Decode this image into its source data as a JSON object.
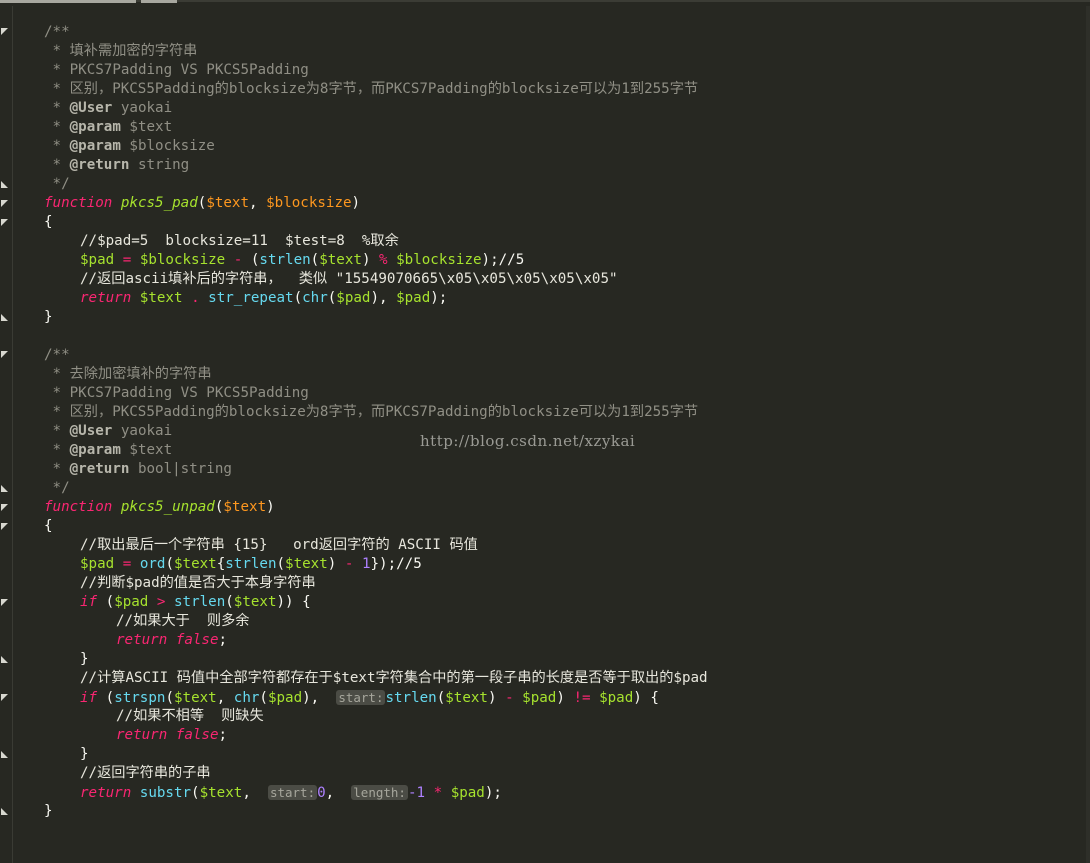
{
  "watermark": "http://blog.csdn.net/xzykai",
  "block1": {
    "doc_open": "/**",
    "doc_title": " * 填补需加密的字符串",
    "doc_l2": " * PKCS7Padding VS PKCS5Padding",
    "doc_l3": " * 区别，PKCS5Padding的blocksize为8字节，而PKCS7Padding的blocksize可以为1到255字节",
    "tag_user": "@User",
    "user_val": " yaokai",
    "tag_param": "@param",
    "param1": " $text",
    "param2": " $blocksize",
    "tag_return": "@return",
    "return_val": " string",
    "doc_close": " */",
    "kw_function": "function",
    "fn_name": "pkcs5_pad",
    "arg1": "$text",
    "arg2": "$blocksize",
    "brace_open": "{",
    "comment1": "//$pad=5  blocksize=11  $test=8  %取余",
    "var_pad": "$pad",
    "var_blocksize": "$blocksize",
    "fn_strlen": "strlen",
    "var_text": "$text",
    "line_tail": ");//5",
    "comment2": "//返回ascii填补后的字符串，  类似 ",
    "comment2_str": "\"15549070665\\x05\\x05\\x05\\x05\\x05\"",
    "kw_return": "return",
    "fn_str_repeat": "str_repeat",
    "fn_chr": "chr",
    "brace_close": "}"
  },
  "block2": {
    "doc_open": "/**",
    "doc_title": " * 去除加密填补的字符串",
    "doc_l2": " * PKCS7Padding VS PKCS5Padding",
    "doc_l3": " * 区别，PKCS5Padding的blocksize为8字节，而PKCS7Padding的blocksize可以为1到255字节",
    "tag_user": "@User",
    "user_val": " yaokai",
    "tag_param": "@param",
    "param1": " $text",
    "tag_return": "@return",
    "return_val": " bool|string",
    "doc_close": " */",
    "kw_function": "function",
    "fn_name": "pkcs5_unpad",
    "arg1": "$text",
    "comment1": "//取出最后一个字符串 {15}   ord返回字符的 ASCII 码值",
    "fn_ord": "ord",
    "comment1_tail": "});//5",
    "comment2": "//判断$pad的值是否大于本身字符串",
    "kw_if": "if",
    "comment3": "//如果大于  则多余",
    "kw_false": "false",
    "comment4": "//计算ASCII 码值中全部字符都存在于$text字符集合中的第一段子串的长度是否等于取出的$pad",
    "fn_strspn": "strspn",
    "hint_start": "start:",
    "comment5": "//如果不相等  则缺失",
    "comment6": "//返回字符串的子串",
    "fn_substr": "substr",
    "hint_length": "length:",
    "num0": "0",
    "num1": "1",
    "num_neg1": "-1"
  }
}
